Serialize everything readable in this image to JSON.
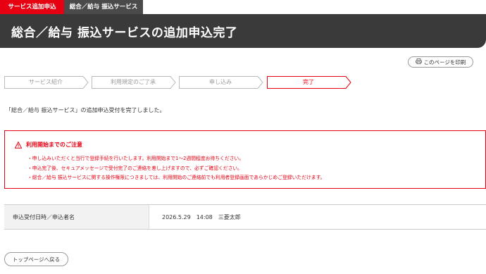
{
  "tabs": {
    "active_label": "サービス追加申込",
    "inactive_label": "総合／給与 振込サービス"
  },
  "header": {
    "title": "総合／給与 振込サービスの追加申込完了"
  },
  "print_button": {
    "icon": "printer-icon",
    "label": "このページを印刷"
  },
  "steps": [
    {
      "label": "サービス紹介",
      "state": "done"
    },
    {
      "label": "利用規定のご了承",
      "state": "done"
    },
    {
      "label": "申し込み",
      "state": "done"
    },
    {
      "label": "完了",
      "state": "current"
    }
  ],
  "message": "「総合／給与 振込サービス」の追加申込受付を完了しました。",
  "notice": {
    "icon": "warning-icon",
    "title": "利用開始までのご注意",
    "items": [
      "申し込みいただくと当行で登録手続を行いたします。利用開始まで1〜2週間程度お待ちください。",
      "申込完了後、セキュアメッセージで受付完了のご連絡を差し上げますので、必ずご確認ください。",
      "総合／給与 振込サービスに関する操作権限につきましては、利用開始のご連絡前でも利用者登録画面であらかじめご登録いただけます。"
    ]
  },
  "info": {
    "label": "申込受付日時／申込者名",
    "date": "2026.5.29",
    "time": "14:08",
    "name": "三菱太郎"
  },
  "top_button": {
    "label": "トップページへ戻る"
  },
  "colors": {
    "accent": "#e60012",
    "header_bg": "#3a3a3a",
    "step_border": "#bbbbbb"
  }
}
